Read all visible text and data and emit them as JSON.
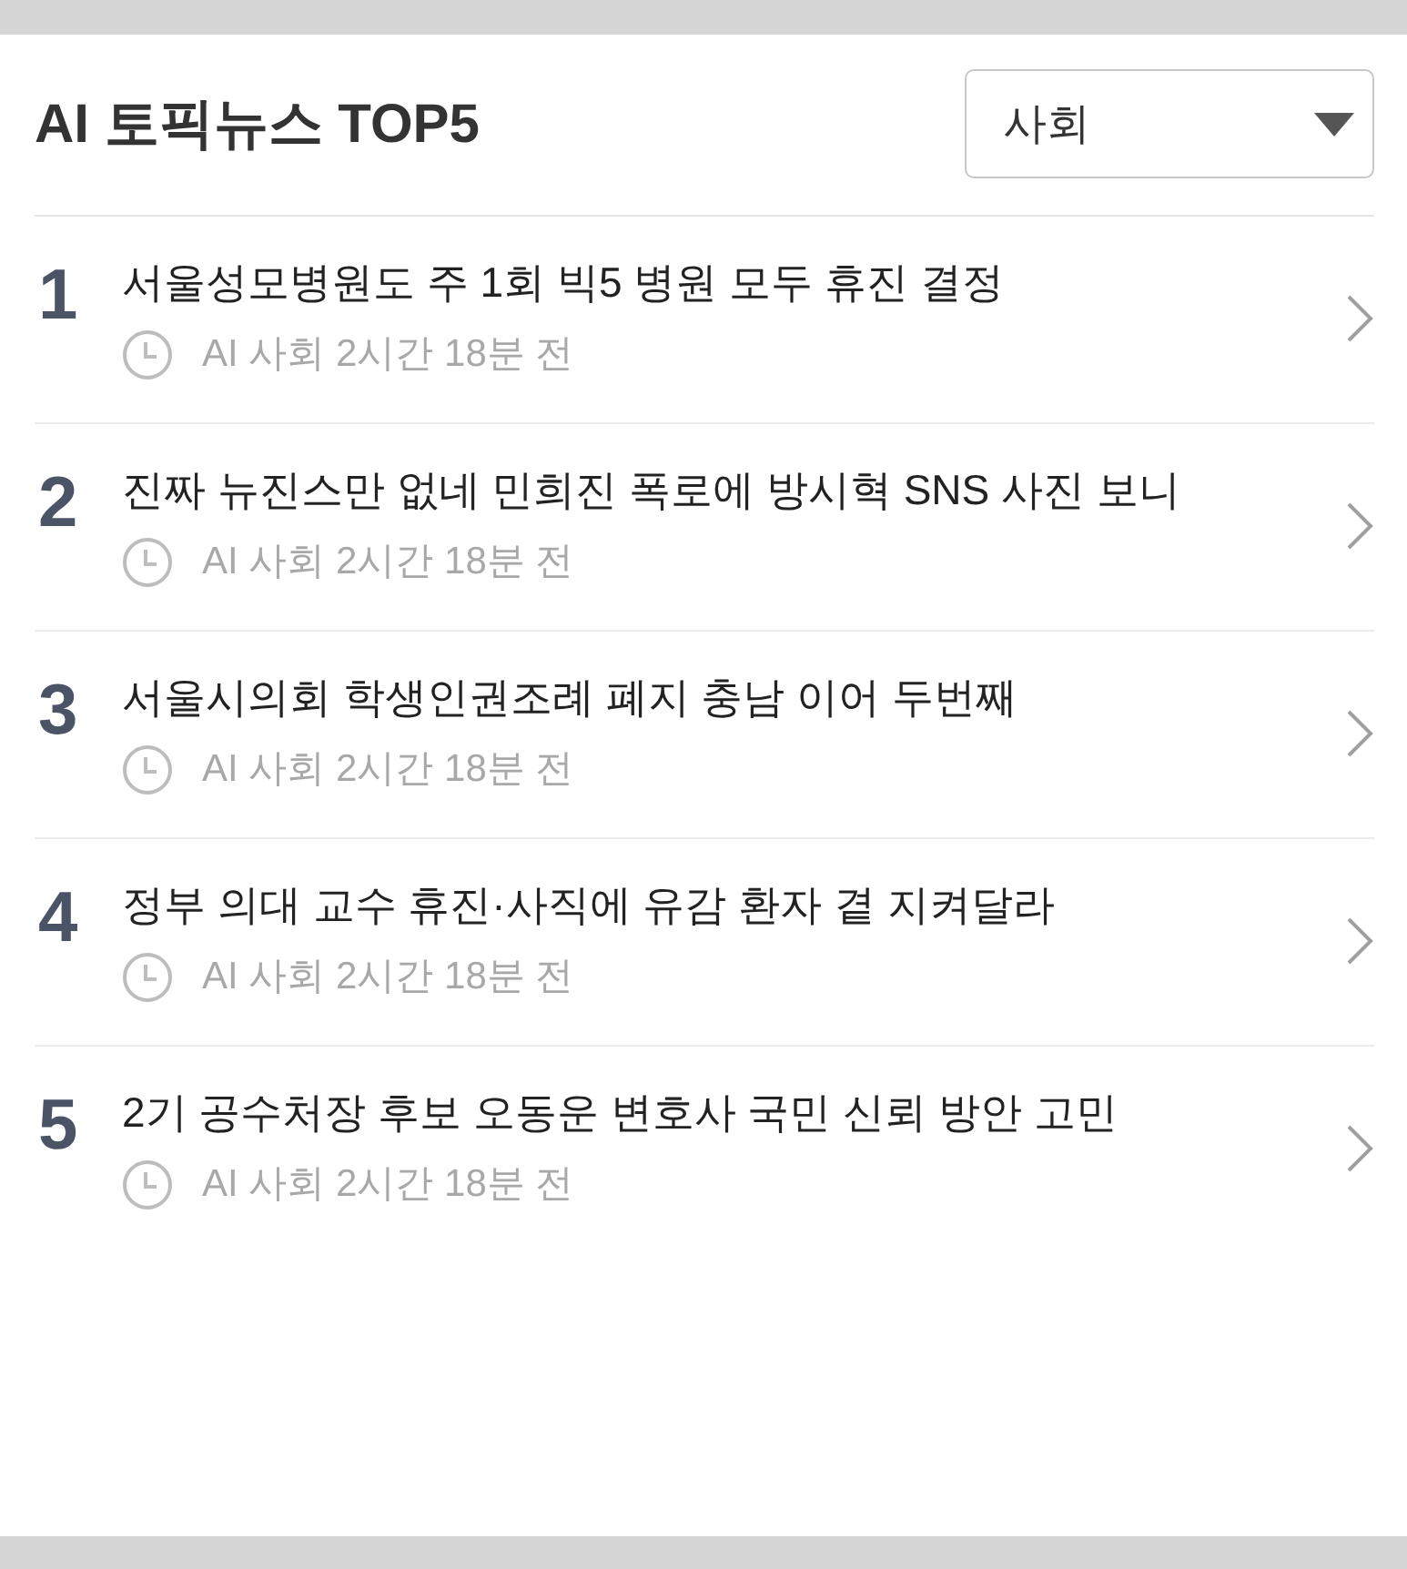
{
  "header": {
    "title": "AI 토픽뉴스 TOP5",
    "category_select": {
      "value": "사회"
    }
  },
  "news": [
    {
      "rank": "1",
      "title": "서울성모병원도 주 1회 빅5 병원 모두 휴진 결정",
      "meta": "AI 사회 2시간 18분 전"
    },
    {
      "rank": "2",
      "title": "진짜 뉴진스만 없네 민희진 폭로에 방시혁 SNS 사진 보니",
      "meta": "AI 사회 2시간 18분 전"
    },
    {
      "rank": "3",
      "title": "서울시의회 학생인권조례 폐지 충남 이어 두번째",
      "meta": "AI 사회 2시간 18분 전"
    },
    {
      "rank": "4",
      "title": "정부 의대 교수 휴진·사직에 유감 환자 곁 지켜달라",
      "meta": "AI 사회 2시간 18분 전"
    },
    {
      "rank": "5",
      "title": "2기 공수처장 후보 오동운 변호사 국민 신뢰 방안 고민",
      "meta": "AI 사회 2시간 18분 전"
    }
  ]
}
